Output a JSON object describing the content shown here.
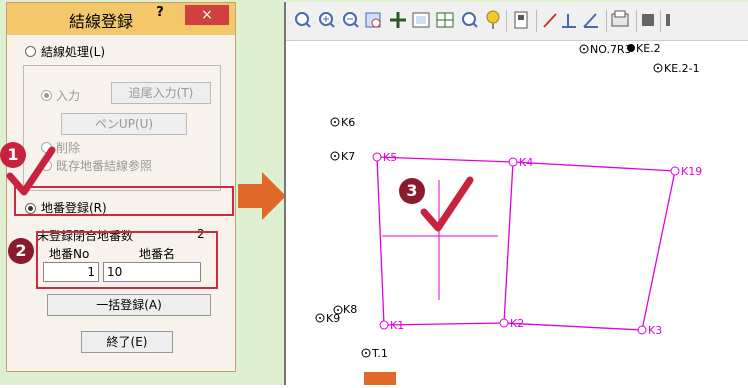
{
  "dialog": {
    "title": "結線登録",
    "help_label": "?",
    "close_label": "×",
    "radio_kessen": "結線処理(L)",
    "radio_input": "入力",
    "btn_tsubi": "追尾入力(T)",
    "btn_penup": "ペンUP(U)",
    "radio_delete": "削除",
    "radio_ref": "既存地番結線参照",
    "radio_chiban": "地番登録(R)",
    "unreg_label": "未登録閉合地番数",
    "unreg_count": "2",
    "col_no": "地番No",
    "col_name": "地番名",
    "chiban_no": "1",
    "chiban_name": "10",
    "btn_bulk": "一括登録(A)",
    "btn_end": "終了(E)"
  },
  "badges": {
    "b1": "1",
    "b2": "2",
    "b3": "3"
  },
  "colors": {
    "accent_red": "#cc2a42",
    "arrow": "#e06a2a",
    "polygon": "#e000e0",
    "title_bar": "#f4c86a"
  },
  "toolbar": {
    "icons": [
      "zoom-icon",
      "zoom-in-icon",
      "zoom-out-icon",
      "zoom-fit-icon",
      "pan-icon",
      "window-icon",
      "grid-icon",
      "search-icon",
      "pin-icon",
      "device-icon",
      "line-icon",
      "perpendicular-icon",
      "angle-icon",
      "print-icon",
      "display-icon"
    ]
  },
  "map": {
    "points": [
      "K6",
      "K7",
      "K5",
      "K4",
      "K19",
      "K8",
      "K9",
      "K1",
      "K2",
      "K3",
      "T.1",
      "NO.7R3",
      "KE.2",
      "KE.2-1"
    ]
  }
}
